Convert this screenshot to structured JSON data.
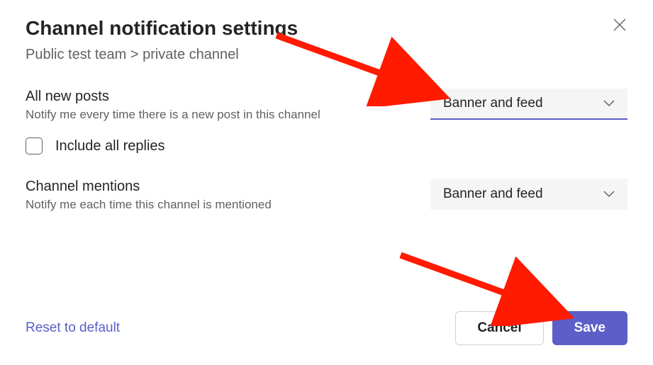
{
  "header": {
    "title": "Channel notification settings",
    "breadcrumb": "Public test team > private channel"
  },
  "settings": {
    "all_new_posts": {
      "title": "All new posts",
      "desc": "Notify me every time there is a new post in this channel",
      "dropdown_value": "Banner and feed"
    },
    "include_replies": {
      "label": "Include all replies"
    },
    "channel_mentions": {
      "title": "Channel mentions",
      "desc": "Notify me each time this channel is mentioned",
      "dropdown_value": "Banner and feed"
    }
  },
  "footer": {
    "reset": "Reset to default",
    "cancel": "Cancel",
    "save": "Save"
  }
}
